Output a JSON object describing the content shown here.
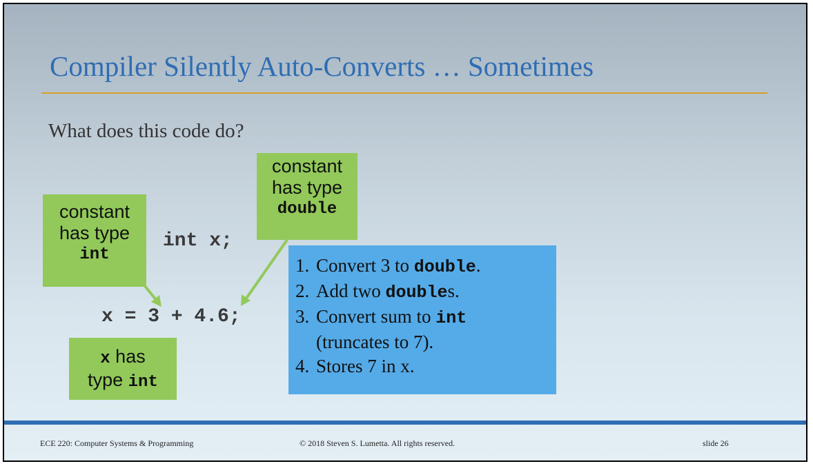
{
  "slide": {
    "title": "Compiler Silently Auto-Converts … Sometimes",
    "question": "What does this code do?"
  },
  "code": {
    "line1": "int x;",
    "line2": "x = 3 + 4.6;"
  },
  "callouts": {
    "int_constant": {
      "line1": "constant",
      "line2": "has type",
      "type": "int"
    },
    "double_constant": {
      "line1": "constant",
      "line2": "has type",
      "type": "double"
    },
    "x_type": {
      "var": "x",
      "has": " has",
      "type_word": "type ",
      "type": "int"
    }
  },
  "steps": [
    {
      "num": "1.",
      "text": "Convert 3 to ",
      "code": "double",
      "after": "."
    },
    {
      "num": "2.",
      "text": "Add two ",
      "code": "double",
      "after": "s."
    },
    {
      "num": "3.",
      "text": "Convert sum to ",
      "code": "int",
      "after": "",
      "cont": "(truncates to 7)."
    },
    {
      "num": "4.",
      "text": "Stores 7 in x.",
      "code": "",
      "after": ""
    }
  ],
  "footer": {
    "course": "ECE 220: Computer Systems & Programming",
    "copyright": "© 2018 Steven S. Lumetta.  All rights reserved.",
    "slide_number": "slide 26"
  },
  "colors": {
    "title": "#2f6db3",
    "accent_rule": "#d4a126",
    "callout_green": "#92c95a",
    "steps_blue": "#55abe8"
  }
}
